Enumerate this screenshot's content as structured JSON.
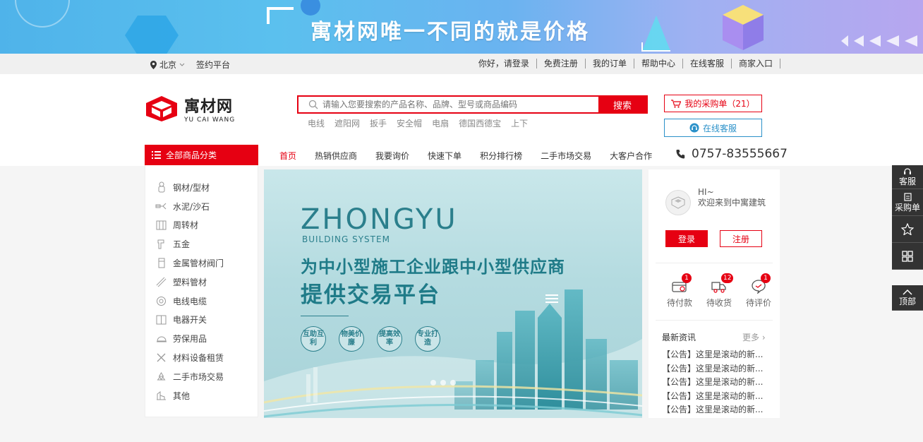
{
  "banner": {
    "slogan": "寓材网唯一不同的就是价格"
  },
  "topbar": {
    "location": "北京",
    "sign_platform": "签约平台",
    "links": [
      "你好，请登录",
      "免费注册",
      "我的订单",
      "帮助中心",
      "在线客服",
      "商家入口"
    ]
  },
  "header": {
    "logo_cn": "寓材网",
    "logo_en": "YU CAI WANG",
    "search_placeholder": "请输入您要搜索的产品名称、品牌、型号或商品编码",
    "search_button": "搜索",
    "hot_words": [
      "电线",
      "遮阳网",
      "扳手",
      "安全帽",
      "电扇",
      "德国西德宝",
      "上下"
    ],
    "cart_label": "我的采购单（21）",
    "service_label": "在线客服"
  },
  "nav": {
    "all_categories": "全部商品分类",
    "links": [
      "首页",
      "热销供应商",
      "我要询价",
      "快速下单",
      "积分排行榜",
      "二手市场交易",
      "大客户合作"
    ],
    "phone": "0757-83555667"
  },
  "categories": [
    {
      "label": "钢材/型材",
      "icon": "steel-icon"
    },
    {
      "label": "水泥/沙石",
      "icon": "cement-icon"
    },
    {
      "label": "周转材",
      "icon": "formwork-icon"
    },
    {
      "label": "五金",
      "icon": "hardware-icon"
    },
    {
      "label": "金属管材阀门",
      "icon": "valve-icon"
    },
    {
      "label": "塑料管材",
      "icon": "plastic-pipe-icon"
    },
    {
      "label": "电线电缆",
      "icon": "cable-icon"
    },
    {
      "label": "电器开关",
      "icon": "switch-icon"
    },
    {
      "label": "劳保用品",
      "icon": "helmet-icon"
    },
    {
      "label": "材料设备租赁",
      "icon": "tools-icon"
    },
    {
      "label": "二手市场交易",
      "icon": "recycle-icon"
    },
    {
      "label": "其他",
      "icon": "other-icon"
    }
  ],
  "hero": {
    "title_en": "ZHONGYU",
    "subtitle_en": "BUILDING SYSTEM",
    "line1": "为中小型施工企业跟中小型供应商",
    "line2": "提供交易平台",
    "badges": [
      "互助互利",
      "物美价廉",
      "提高效率",
      "专业打造"
    ]
  },
  "user": {
    "hi": "HI~",
    "welcome": "欢迎来到中寓建筑",
    "login": "登录",
    "register": "注册",
    "orders": [
      {
        "label": "待付款",
        "count": "1",
        "icon": "wallet-icon"
      },
      {
        "label": "待收货",
        "count": "12",
        "icon": "truck-icon"
      },
      {
        "label": "待评价",
        "count": "1",
        "icon": "comment-icon"
      }
    ],
    "news_title": "最新资讯",
    "news_more": "更多 ›",
    "news": [
      "【公告】这里是滚动的新...",
      "【公告】这里是滚动的新...",
      "【公告】这里是滚动的新...",
      "【公告】这里是滚动的新...",
      "【公告】这里是滚动的新..."
    ]
  },
  "sidebar_tools": {
    "service": "客服",
    "cart": "采购单",
    "top": "顶部"
  },
  "colors": {
    "accent": "#e60012",
    "service_blue": "#2b91c9",
    "hero_teal": "#1f7b88"
  }
}
